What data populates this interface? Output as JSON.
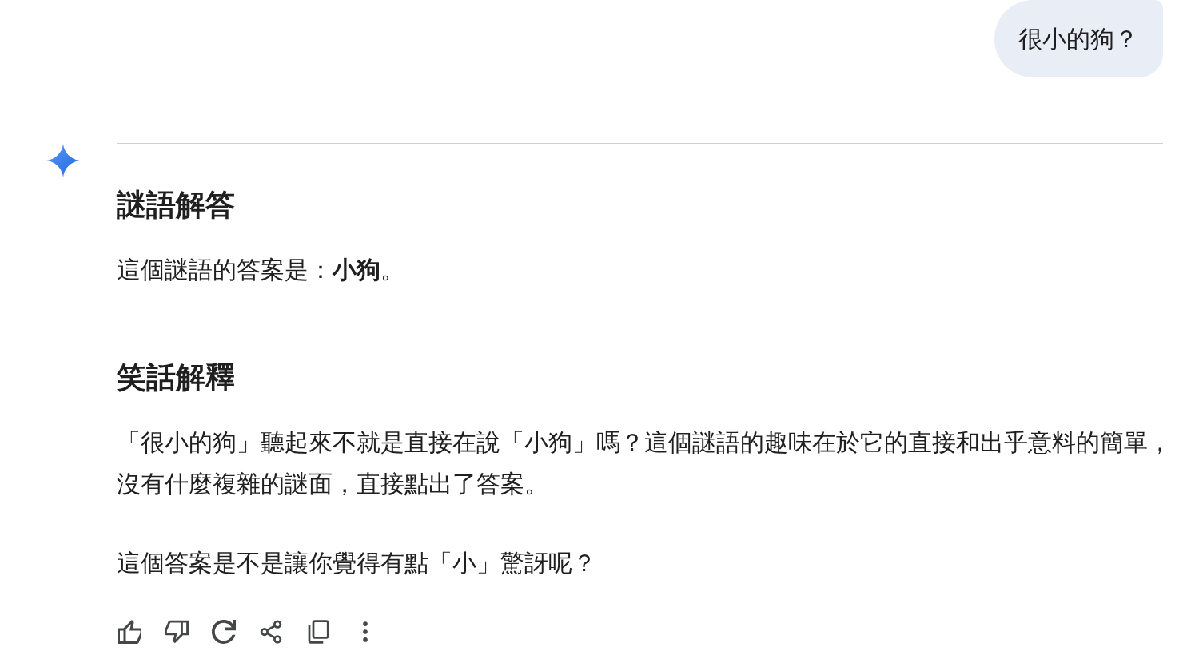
{
  "user_message": {
    "text": "很小的狗？"
  },
  "response": {
    "sections": [
      {
        "heading": "謎語解答",
        "paragraphs": [
          "這個謎語的答案是：**小狗**。"
        ]
      },
      {
        "heading": "笑話解釋",
        "paragraphs": [
          "「很小的狗」聽起來不就是直接在說「小狗」嗎？這個謎語的趣味在於它的直接和出乎意料的簡單，沒有什麼複雜的謎面，直接點出了答案。"
        ]
      }
    ],
    "closing": "這個答案是不是讓你覺得有點「小」驚訝呢？"
  }
}
